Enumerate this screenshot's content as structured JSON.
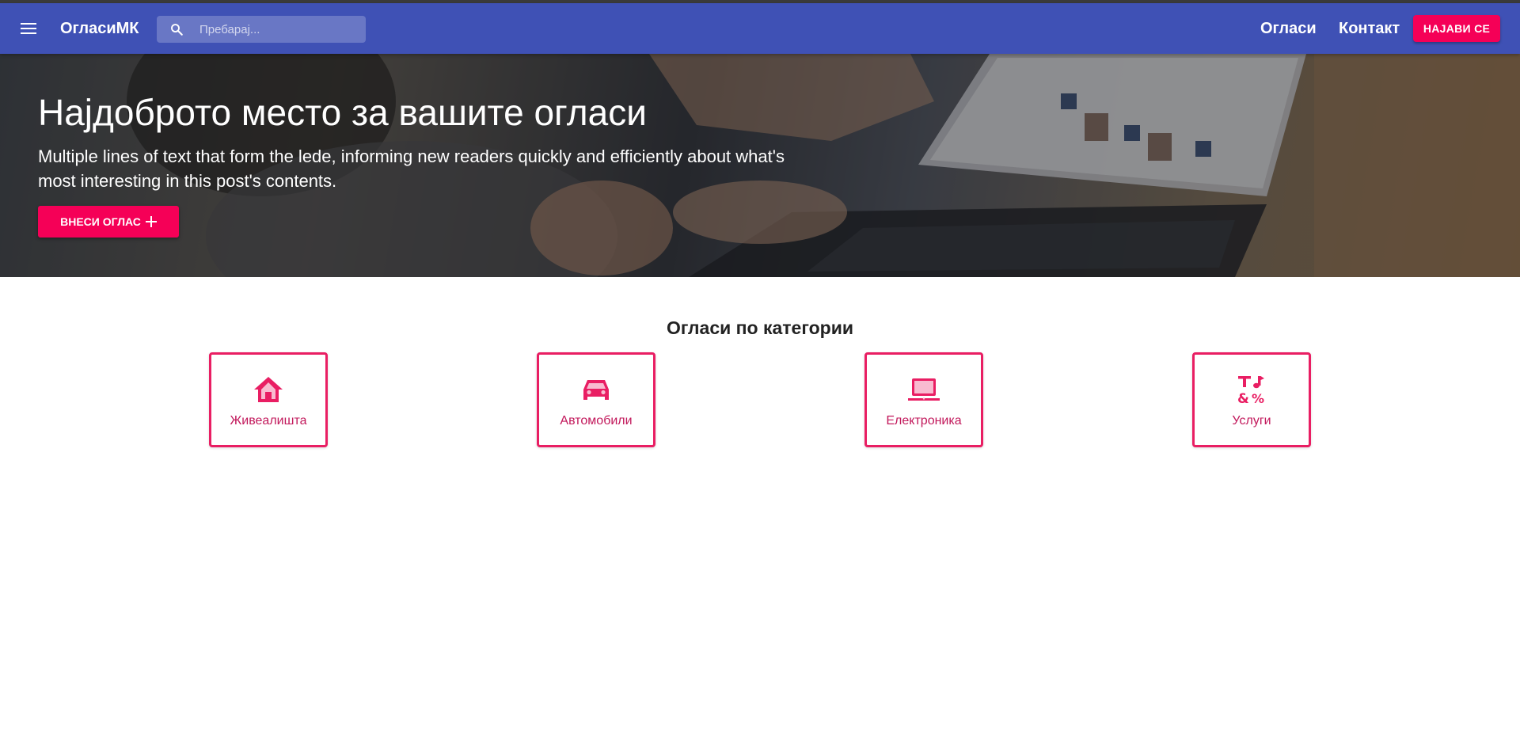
{
  "header": {
    "brand": "ОгласиМК",
    "search_placeholder": "Пребарај...",
    "nav_ads": "Огласи",
    "nav_contact": "Контакт",
    "login_label": "НАЈАВИ СЕ"
  },
  "hero": {
    "title": "Најдоброто место за вашите огласи",
    "lede": "Multiple lines of text that form the lede, informing new readers quickly and efficiently about what's most interesting in this post's contents.",
    "post_button_label": "ВНЕСИ ОГЛАС"
  },
  "categories_section": {
    "title": "Огласи по категории",
    "items": [
      {
        "label": "Живеалишта",
        "icon": "home-icon"
      },
      {
        "label": "Автомобили",
        "icon": "car-icon"
      },
      {
        "label": "Електроника",
        "icon": "laptop-icon"
      },
      {
        "label": "Услуги",
        "icon": "services-icon"
      }
    ]
  },
  "colors": {
    "appbar": "#3f51b5",
    "accent": "#f50057",
    "category_border": "#e91e63"
  }
}
